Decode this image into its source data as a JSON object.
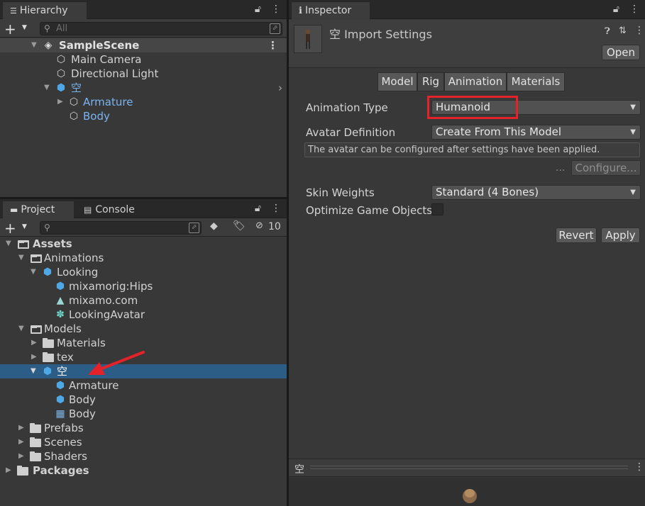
{
  "hierarchy": {
    "tab_label": "Hierarchy",
    "search_placeholder": "All",
    "scene": "SampleScene",
    "items": [
      {
        "label": "Main Camera",
        "icon": "gameobject-cube-icon"
      },
      {
        "label": "Directional Light",
        "icon": "gameobject-cube-icon"
      },
      {
        "label": "空",
        "icon": "prefab-blue-cube-icon"
      },
      {
        "label": "Armature",
        "icon": "gameobject-cube-icon"
      },
      {
        "label": "Body",
        "icon": "gameobject-cube-icon"
      }
    ]
  },
  "project": {
    "tab_project": "Project",
    "tab_console": "Console",
    "hidden_count": "10",
    "tree": [
      {
        "label": "Assets"
      },
      {
        "label": "Animations"
      },
      {
        "label": "Looking"
      },
      {
        "label": "mixamorig:Hips"
      },
      {
        "label": "mixamo.com"
      },
      {
        "label": "LookingAvatar"
      },
      {
        "label": "Models"
      },
      {
        "label": "Materials"
      },
      {
        "label": "tex"
      },
      {
        "label": "空"
      },
      {
        "label": "Armature"
      },
      {
        "label": "Body"
      },
      {
        "label": "Body"
      },
      {
        "label": "Prefabs"
      },
      {
        "label": "Scenes"
      },
      {
        "label": "Shaders"
      },
      {
        "label": "Packages"
      }
    ]
  },
  "inspector": {
    "tab_label": "Inspector",
    "title": "空 Import Settings",
    "open_button": "Open",
    "tabs": [
      "Model",
      "Rig",
      "Animation",
      "Materials"
    ],
    "active_tab": "Rig",
    "animation_type_label": "Animation Type",
    "animation_type_value": "Humanoid",
    "avatar_definition_label": "Avatar Definition",
    "avatar_definition_value": "Create From This Model",
    "help_text": "The avatar can be configured after settings have been applied.",
    "ellipsis": "...",
    "configure_button": "Configure...",
    "skin_weights_label": "Skin Weights",
    "skin_weights_value": "Standard (4 Bones)",
    "optimize_label": "Optimize Game Objects",
    "revert_button": "Revert",
    "apply_button": "Apply",
    "preview_title": "空",
    "highlight_color": "#e3222a",
    "selection_color": "#2c5d87"
  }
}
